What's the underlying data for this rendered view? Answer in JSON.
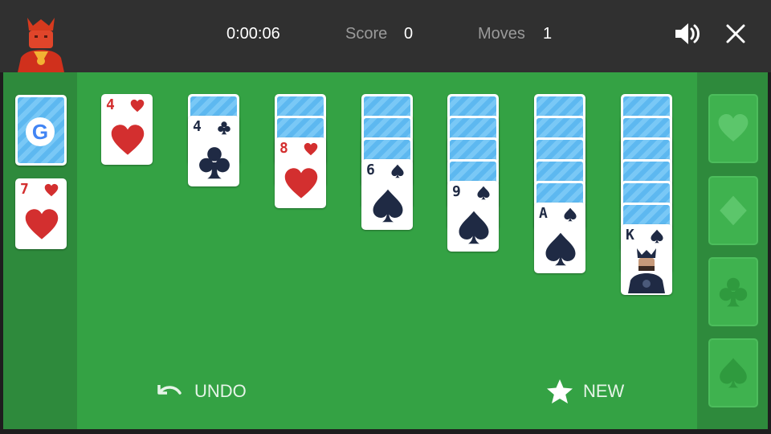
{
  "header": {
    "timer": "0:00:06",
    "score_label": "Score",
    "score_value": "0",
    "moves_label": "Moves",
    "moves_value": "1",
    "avatar_icon": "king-avatar-icon",
    "sound_icon": "speaker-icon",
    "close_icon": "close-icon"
  },
  "stock": {
    "back_logo": "G"
  },
  "waste": {
    "rank": "7",
    "suit": "heart"
  },
  "tableau": [
    {
      "rank": "4",
      "suit": "heart"
    },
    {
      "rank": "4",
      "suit": "club"
    },
    {
      "rank": "8",
      "suit": "heart"
    },
    {
      "rank": "6",
      "suit": "spade"
    },
    {
      "rank": "9",
      "suit": "spade"
    },
    {
      "rank": "A",
      "suit": "spade"
    },
    {
      "rank": "K",
      "suit": "spade"
    }
  ],
  "foundations": [
    "heart",
    "diamond",
    "club",
    "spade"
  ],
  "actions": {
    "undo_label": "UNDO",
    "new_label": "NEW"
  },
  "colors": {
    "felt": "#34a244",
    "side_felt": "#2e8a3c",
    "header": "#303030",
    "red_suit": "#d32f2f",
    "dark_suit": "#1f2a44",
    "card_back": "#5db8f0"
  }
}
